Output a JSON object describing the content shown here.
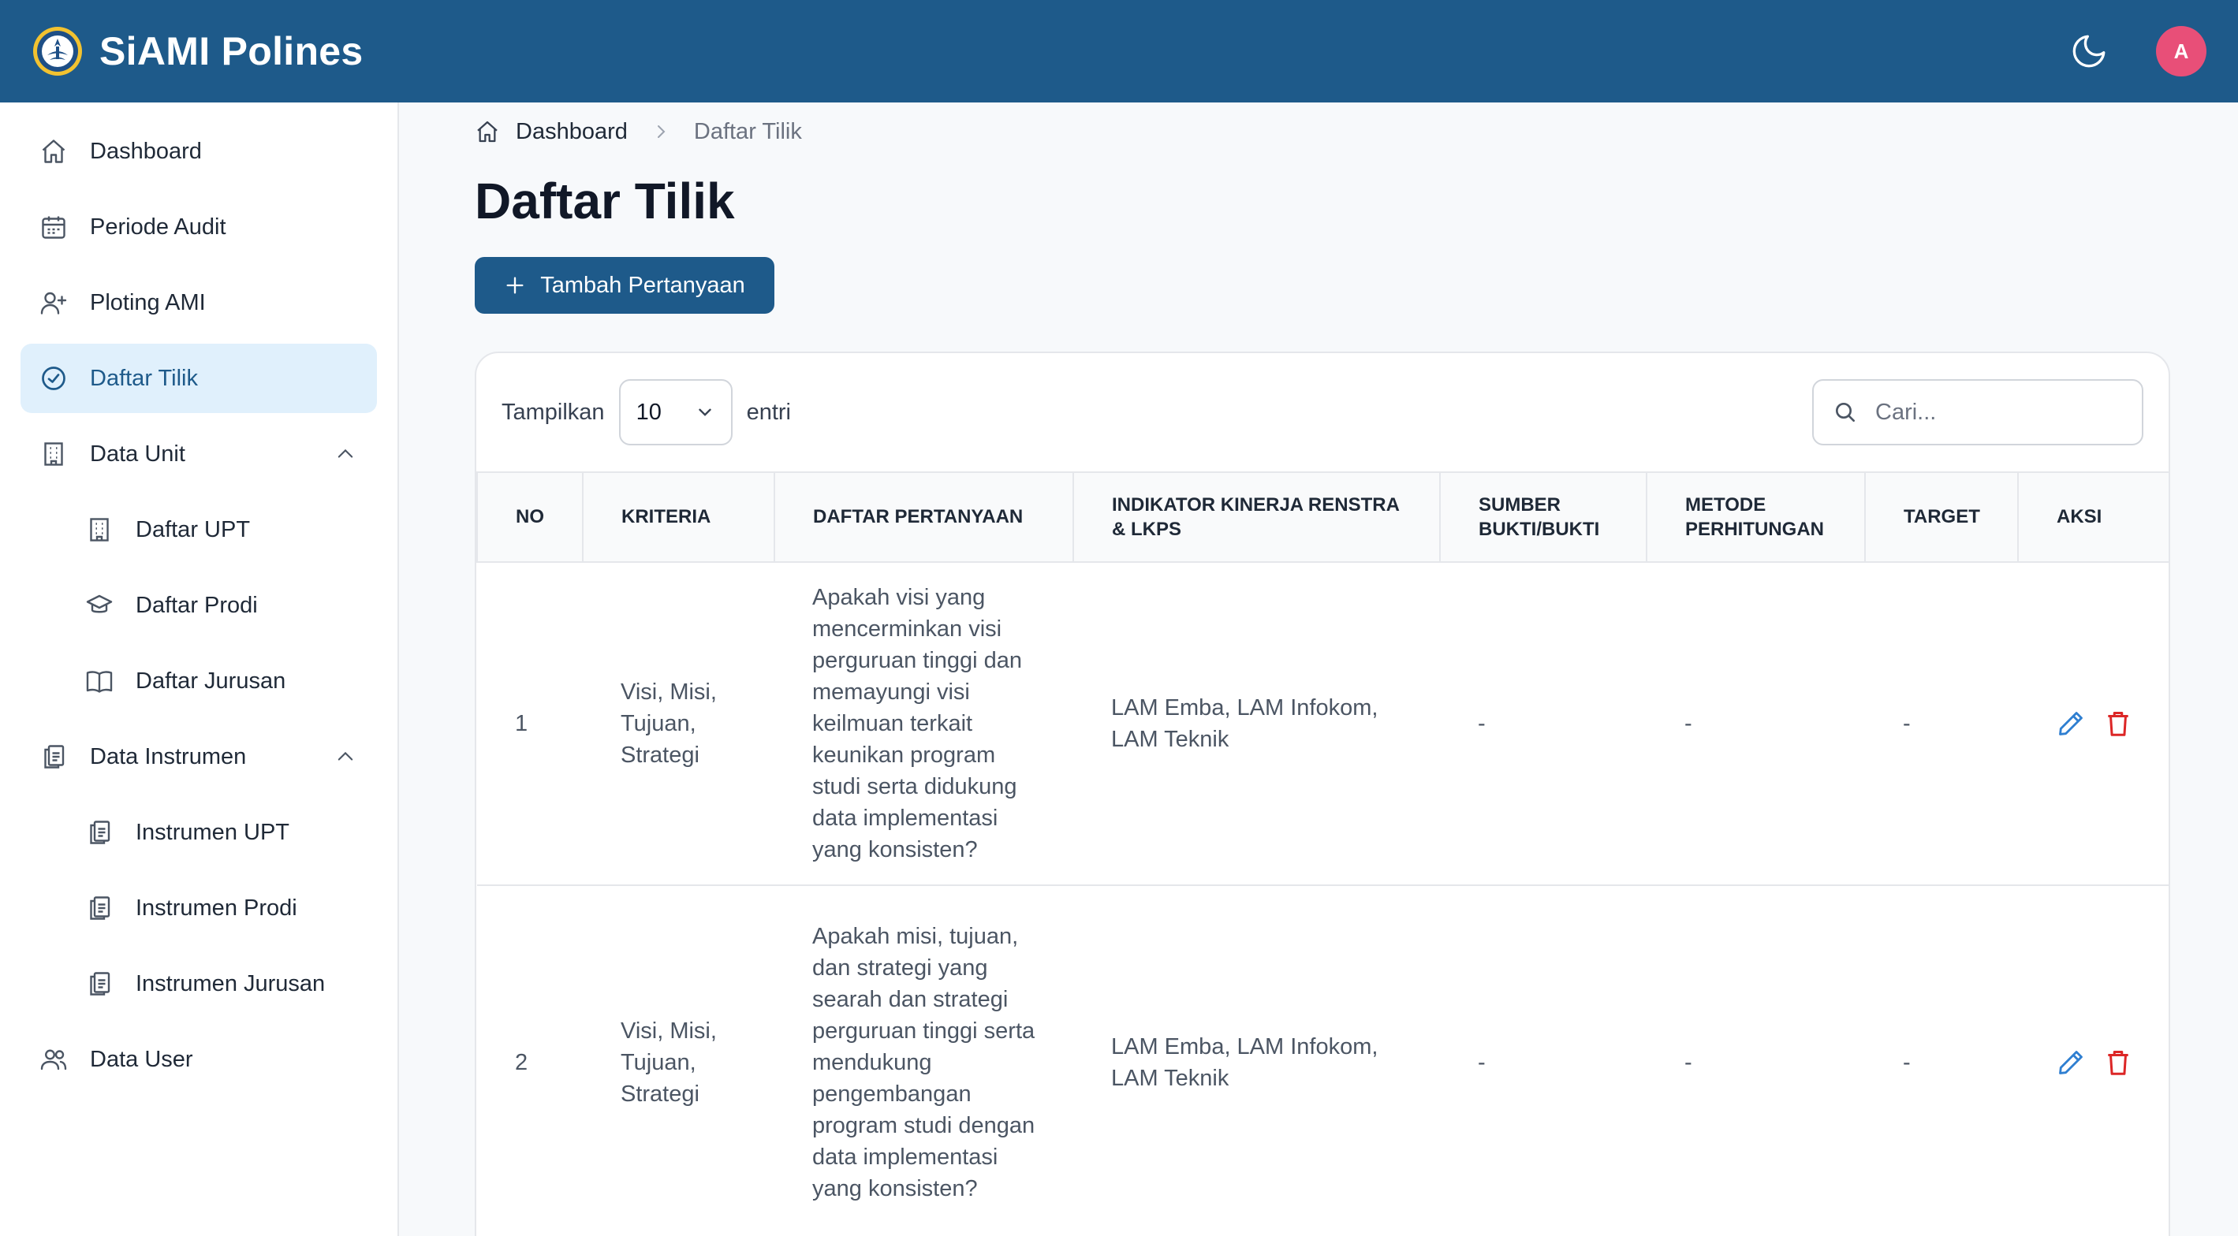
{
  "header": {
    "app_title": "SiAMI Polines",
    "avatar_initial": "A"
  },
  "sidebar": {
    "items": [
      {
        "label": "Dashboard",
        "icon": "home-icon"
      },
      {
        "label": "Periode Audit",
        "icon": "calendar-icon"
      },
      {
        "label": "Ploting AMI",
        "icon": "user-plus-icon"
      },
      {
        "label": "Daftar Tilik",
        "icon": "check-circle-icon",
        "active": true
      },
      {
        "label": "Data Unit",
        "icon": "building-icon",
        "expanded": true
      },
      {
        "label": "Daftar UPT",
        "icon": "building-icon"
      },
      {
        "label": "Daftar Prodi",
        "icon": "graduation-cap-icon"
      },
      {
        "label": "Daftar Jurusan",
        "icon": "book-icon"
      },
      {
        "label": "Data Instrumen",
        "icon": "clipboard-icon",
        "expanded": true
      },
      {
        "label": "Instrumen UPT",
        "icon": "clipboard-icon"
      },
      {
        "label": "Instrumen Prodi",
        "icon": "clipboard-icon"
      },
      {
        "label": "Instrumen Jurusan",
        "icon": "clipboard-icon"
      },
      {
        "label": "Data User",
        "icon": "users-icon"
      }
    ]
  },
  "breadcrumb": {
    "home": "Dashboard",
    "current": "Daftar Tilik"
  },
  "page": {
    "title": "Daftar Tilik",
    "add_button": "Tambah Pertanyaan"
  },
  "table_controls": {
    "show_label": "Tampilkan",
    "page_size": "10",
    "entries_label": "entri",
    "search_placeholder": "Cari..."
  },
  "table": {
    "headers": [
      "NO",
      "KRITERIA",
      "DAFTAR PERTANYAAN",
      "INDIKATOR KINERJA RENSTRA & LKPS",
      "SUMBER BUKTI/BUKTI",
      "METODE PERHITUNGAN",
      "TARGET",
      "AKSI"
    ],
    "rows": [
      {
        "no": "1",
        "kriteria": "Visi, Misi, Tujuan, Strategi",
        "pertanyaan": "Apakah visi yang mencerminkan visi perguruan tinggi dan memayungi visi keilmuan terkait keunikan program studi serta didukung data implementasi yang konsisten?",
        "indikator": "LAM Emba, LAM Infokom, LAM Teknik",
        "sumber": "-",
        "metode": "-",
        "target": "-"
      },
      {
        "no": "2",
        "kriteria": "Visi, Misi, Tujuan, Strategi",
        "pertanyaan": "Apakah misi, tujuan, dan strategi yang searah dan strategi perguruan tinggi serta mendukung pengembangan program studi dengan data implementasi yang konsisten?",
        "indikator": "LAM Emba, LAM Infokom, LAM Teknik",
        "sumber": "-",
        "metode": "-",
        "target": "-"
      }
    ]
  },
  "colors": {
    "primary": "#1e5a8a",
    "active_bg": "#e0f0fc",
    "avatar": "#e84f78",
    "edit": "#2f7fd1",
    "delete": "#dc2626"
  }
}
